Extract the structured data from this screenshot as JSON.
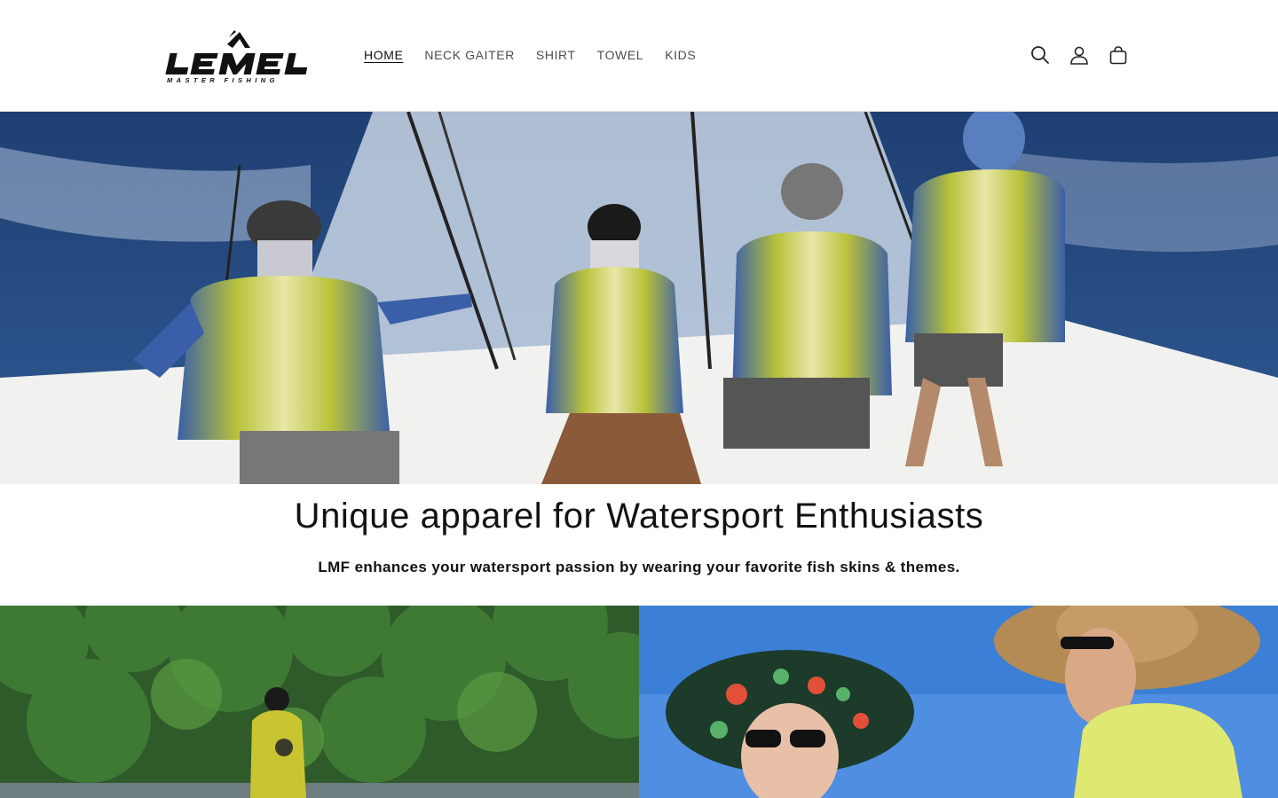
{
  "brand": {
    "logo_text": "LEMEL",
    "logo_subtext": "MASTER FISHING"
  },
  "nav": {
    "items": [
      {
        "label": "HOME",
        "active": true
      },
      {
        "label": "NECK GAITER",
        "active": false
      },
      {
        "label": "SHIRT",
        "active": false
      },
      {
        "label": "TOWEL",
        "active": false
      },
      {
        "label": "KIDS",
        "active": false
      }
    ]
  },
  "header_icons": [
    "search-icon",
    "account-icon",
    "cart-icon"
  ],
  "hero": {
    "image": "four anglers in fish-skin shirts at the stern of a fishing boat"
  },
  "intro": {
    "headline": "Unique apparel for Watersport Enthusiasts",
    "subline": "LMF enhances your watersport passion by wearing your favorite fish skins & themes."
  },
  "tiles": [
    {
      "image": "angler standing in a lake with forest behind"
    },
    {
      "image": "two people wearing wide straw hats on a boat under blue sky"
    }
  ],
  "colors": {
    "text": "#121212",
    "nav_text": "#4d4d4d",
    "shirt_yellow": "#c9c532",
    "shirt_blue": "#3a5fa8",
    "sea_blue": "#2c4f86"
  }
}
